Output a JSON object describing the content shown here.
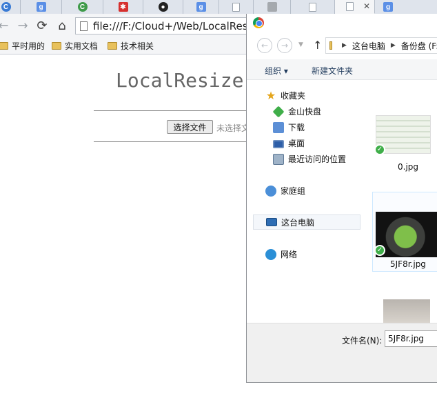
{
  "browser": {
    "tabs": [
      {
        "icon": "chrome-c-icon",
        "active": false
      },
      {
        "icon": "google-icon",
        "active": false
      },
      {
        "icon": "chrome-green-icon",
        "active": false
      },
      {
        "icon": "asterisk-icon",
        "active": false
      },
      {
        "icon": "github-icon",
        "active": false
      },
      {
        "icon": "google-icon",
        "active": false
      },
      {
        "icon": "document-icon",
        "active": false
      },
      {
        "icon": "gray-app-icon",
        "active": false
      },
      {
        "icon": "document-icon",
        "active": false
      },
      {
        "icon": "document-icon",
        "active": true
      },
      {
        "icon": "google-icon",
        "active": false
      }
    ],
    "tab_close": "✕",
    "url": "file:///F:/Cloud+/Web/LocalResize",
    "bookmarks": [
      {
        "label": "平时用的"
      },
      {
        "label": "实用文档"
      },
      {
        "label": "技术相关"
      }
    ]
  },
  "page": {
    "title": "LocalResize",
    "file_button": "选择文件",
    "file_status": "未选择文件"
  },
  "dialog": {
    "breadcrumb": [
      "这台电脑",
      "备份盘 (F:)"
    ],
    "commands": {
      "organize": "组织 ▾",
      "new_folder": "新建文件夹"
    },
    "nav": {
      "favorites": "收藏夹",
      "kingsoft": "金山快盘",
      "downloads": "下载",
      "desktop": "桌面",
      "recent": "最近访问的位置",
      "homegroup": "家庭组",
      "this_pc": "这台电脑",
      "network": "网络"
    },
    "files": [
      {
        "name": "0.jpg"
      },
      {
        "name": "5JF8r.jpg"
      }
    ],
    "filename_label": "文件名(N):",
    "filename_value": "5JF8r.jpg"
  },
  "colors": {
    "accent": "#1e395b",
    "sync_check": "#3fae49"
  }
}
